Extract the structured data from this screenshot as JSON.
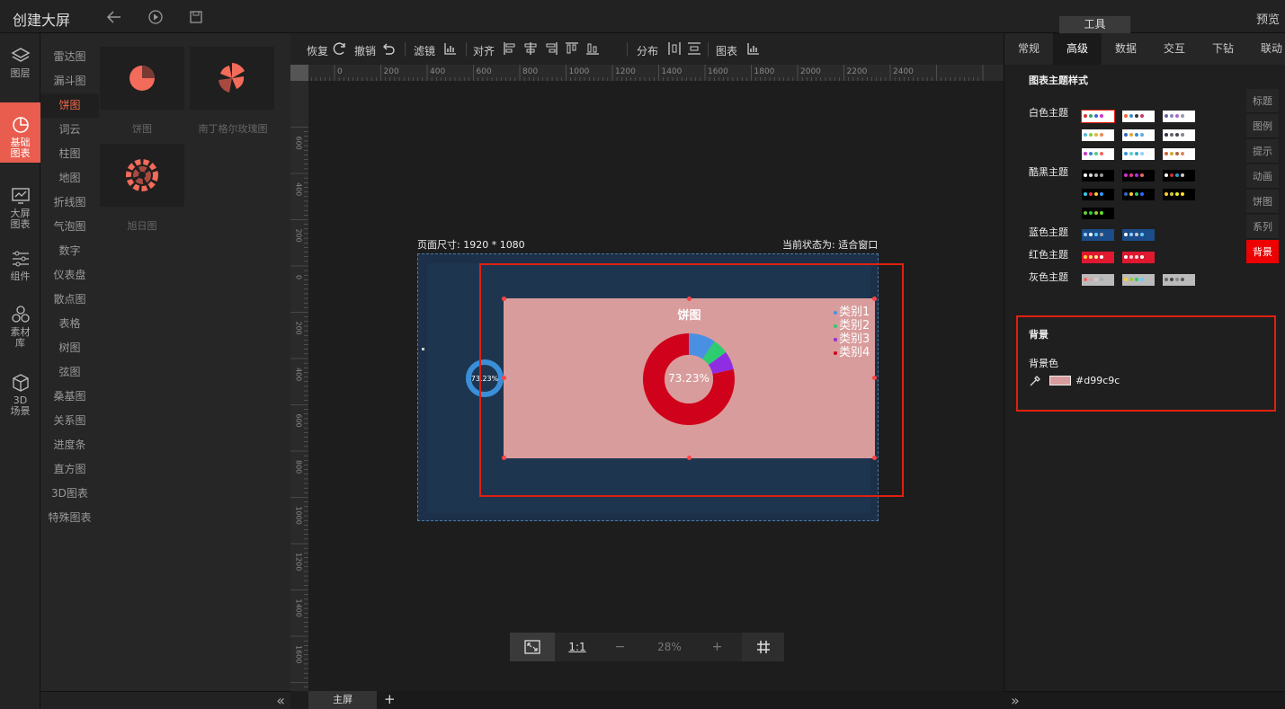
{
  "app": {
    "title": "创建大屏",
    "tool_tab": "工具",
    "preview": "预览"
  },
  "iconbar": [
    {
      "label": "图层",
      "icon": "layers-icon"
    },
    {
      "label": "基础图表",
      "icon": "pie-chart-icon",
      "active": true
    },
    {
      "label": "大屏图表",
      "icon": "monitor-chart-icon"
    },
    {
      "label": "组件",
      "icon": "sliders-icon"
    },
    {
      "label": "素材库",
      "icon": "hexagons-icon"
    },
    {
      "label": "3D场景",
      "icon": "cube-icon"
    }
  ],
  "categories": [
    "雷达图",
    "漏斗图",
    "饼图",
    "词云",
    "柱图",
    "地图",
    "折线图",
    "气泡图",
    "数字",
    "仪表盘",
    "散点图",
    "表格",
    "树图",
    "弦图",
    "桑基图",
    "关系图",
    "进度条",
    "直方图",
    "3D图表",
    "特殊图表"
  ],
  "active_category": "饼图",
  "thumbs": [
    {
      "label": "饼图"
    },
    {
      "label": "南丁格尔玫瑰图"
    },
    {
      "label": "旭日图"
    }
  ],
  "toolbar": {
    "redo": "恢复",
    "undo": "撤销",
    "filter": "滤镜",
    "align": "对齐",
    "distribute": "分布",
    "chart": "图表"
  },
  "ruler_h": [
    "400",
    "200",
    "0",
    "200",
    "400",
    "600",
    "800",
    "1000",
    "1200",
    "1400",
    "1600",
    "1800",
    "2000",
    "2200",
    "2400"
  ],
  "ruler_v": [
    "600",
    "400",
    "200",
    "0",
    "200",
    "400",
    "600",
    "800",
    "1000",
    "1200",
    "1400",
    "1600",
    "1800"
  ],
  "canvas": {
    "page_size": "页面尺寸: 1920 * 1080",
    "state": "当前状态为: 适合窗口",
    "small_donut_value": "73.23%"
  },
  "pie_chart": {
    "title": "饼图",
    "center_value": "73.23%",
    "legend": [
      {
        "name": "类别1",
        "color": "#4a90e2"
      },
      {
        "name": "类别2",
        "color": "#2ecc71"
      },
      {
        "name": "类别3",
        "color": "#8e2de2"
      },
      {
        "name": "类别4",
        "color": "#d0021b"
      }
    ],
    "background": "#d99c9c"
  },
  "chart_data": {
    "type": "pie",
    "title": "饼图",
    "categories": [
      "类别1",
      "类别2",
      "类别3",
      "类别4"
    ],
    "values": [
      9.5,
      5.5,
      6.5,
      78.5
    ]
  },
  "bottom_controls": {
    "fit": "fit-screen-icon",
    "one_to_one": "1:1",
    "minus": "−",
    "zoom": "28%",
    "plus": "+",
    "grid": "grid-icon"
  },
  "screen_tab": "主屏",
  "add_tab": "+",
  "right_tabs": [
    "常规",
    "高级",
    "数据",
    "交互",
    "下钻",
    "联动"
  ],
  "active_right_tab": "高级",
  "theme": {
    "heading": "图表主题样式",
    "groups": [
      {
        "label": "白色主题"
      },
      {
        "label": "酷黑主题"
      },
      {
        "label": "蓝色主题"
      },
      {
        "label": "红色主题"
      },
      {
        "label": "灰色主题"
      }
    ]
  },
  "side_tabs": [
    "标题",
    "图例",
    "提示",
    "动画",
    "饼图",
    "系列",
    "背景"
  ],
  "background_section": {
    "title": "背景",
    "label": "背景色",
    "value": "#d99c9c"
  }
}
